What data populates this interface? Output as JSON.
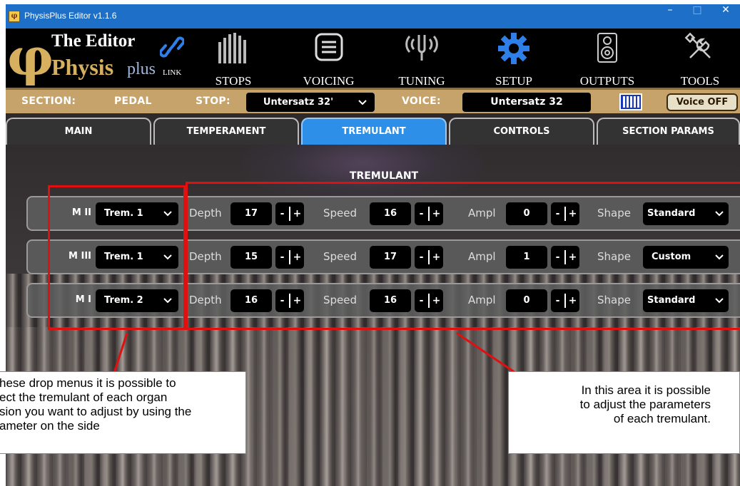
{
  "window": {
    "title": "PhysisPlus Editor v1.1.6",
    "minimize": "–",
    "maximize": "□",
    "close": "✕"
  },
  "logo": {
    "line1": "The Editor",
    "physis": "Physis",
    "plus": "plus",
    "link_label": "LINK"
  },
  "nav": [
    {
      "label": "STOPS",
      "icon": "organ-pipes-icon"
    },
    {
      "label": "VOICING",
      "icon": "list-icon"
    },
    {
      "label": "TUNING",
      "icon": "tuning-fork-icon"
    },
    {
      "label": "SETUP",
      "icon": "gear-icon",
      "active_color": "#2f7fe8"
    },
    {
      "label": "OUTPUTS",
      "icon": "speaker-icon"
    },
    {
      "label": "TOOLS",
      "icon": "tools-icon"
    }
  ],
  "section_bar": {
    "section_label": "SECTION:",
    "section_value": "PEDAL",
    "stop_label": "STOP:",
    "stop_value": "Untersatz 32'",
    "voice_label": "VOICE:",
    "voice_value": "Untersatz 32",
    "voice_button": "Voice OFF"
  },
  "tabs": [
    "MAIN",
    "TEMPERAMENT",
    "TREMULANT",
    "CONTROLS",
    "SECTION PARAMS"
  ],
  "active_tab": "TREMULANT",
  "panel_title": "TREMULANT",
  "param_labels": {
    "depth": "Depth",
    "speed": "Speed",
    "ampl": "Ampl",
    "shape": "Shape",
    "minus": "-",
    "plus": "+"
  },
  "rows": [
    {
      "division": "M II",
      "trem": "Trem. 1",
      "depth": "17",
      "speed": "16",
      "ampl": "0",
      "shape": "Standard"
    },
    {
      "division": "M III",
      "trem": "Trem. 1",
      "depth": "15",
      "speed": "17",
      "ampl": "1",
      "shape": "Custom"
    },
    {
      "division": "M I",
      "trem": "Trem. 2",
      "depth": "16",
      "speed": "16",
      "ampl": "0",
      "shape": "Standard"
    }
  ],
  "annotations": {
    "left": [
      "hese drop menus it is possible to",
      "ect the tremulant of each organ",
      "sion you want to adjust by using the",
      "ameter on the side"
    ],
    "right": [
      "In this area it is possible",
      "to adjust the parameters",
      "of each tremulant."
    ]
  },
  "colors": {
    "title_bar": "#1e6fc7",
    "active_tab": "#2d8fe8",
    "section_bar": "#c5a36b",
    "annotation_red": "#e01010",
    "logo_gold": "#d6b05e"
  }
}
